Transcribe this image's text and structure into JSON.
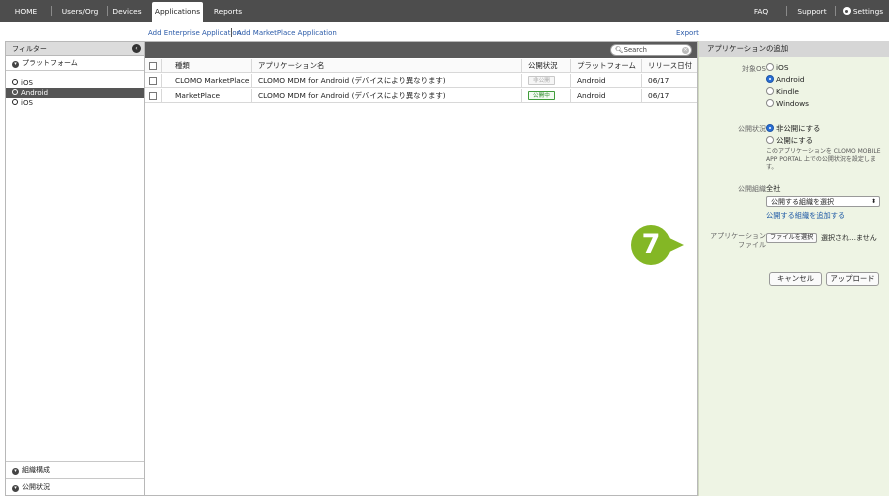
{
  "nav": {
    "tabs": [
      {
        "label": "HOME"
      },
      {
        "label": "Users/Org"
      },
      {
        "label": "Devices"
      },
      {
        "label": "Applications"
      },
      {
        "label": "Reports"
      }
    ],
    "right": [
      {
        "label": "FAQ"
      },
      {
        "label": "Support"
      },
      {
        "label": "Settings"
      }
    ]
  },
  "actions": {
    "add_enterprise": "Add Enterprise Application",
    "add_marketplace": "Add MarketPlace Application",
    "export": "Export"
  },
  "filter": {
    "title": "フィルター",
    "platform_label": "プラットフォーム",
    "items": [
      {
        "label": "iOS",
        "selected": false
      },
      {
        "label": "Android",
        "selected": true
      },
      {
        "label": "iOS",
        "selected": false
      }
    ],
    "org_label": "組織構成",
    "status_label": "公開状況"
  },
  "list": {
    "search_placeholder": "Search",
    "columns": [
      "種類",
      "アプリケーション名",
      "公開状況",
      "プラットフォーム",
      "リリース日付"
    ],
    "rows": [
      {
        "type": "CLOMO MarketPlace",
        "name": "CLOMO MDM for Android (デバイスにより異なります)",
        "status": "非公開",
        "status_kind": "private",
        "platform": "Android",
        "date": "06/17"
      },
      {
        "type": "MarketPlace",
        "name": "CLOMO MDM for Android (デバイスにより異なります)",
        "status": "公開中",
        "status_kind": "public",
        "platform": "Android",
        "date": "06/17"
      }
    ]
  },
  "panel": {
    "title": "アプリケーションの追加",
    "os_label": "対象OS",
    "os_options": [
      "iOS",
      "Android",
      "Kindle",
      "Windows"
    ],
    "os_selected": "Android",
    "visibility_label": "公開状況",
    "visibility_options": [
      "非公開にする",
      "公開にする"
    ],
    "visibility_selected": "非公開にする",
    "visibility_note": "このアプリケーションを CLOMO MOBILE APP PORTAL 上での公開状況を設定します。",
    "org_label": "公開組織",
    "org_value": "全社",
    "org_select": "公開する組織を選択",
    "org_add_link": "公開する組織を追加する",
    "file_label_1": "アプリケーション",
    "file_label_2": "ファイル",
    "file_button": "ファイルを選択",
    "file_status": "選択され…ません",
    "cancel": "キャンセル",
    "upload": "アップロード"
  },
  "callout": {
    "number": "7",
    "color": "#84b725"
  }
}
